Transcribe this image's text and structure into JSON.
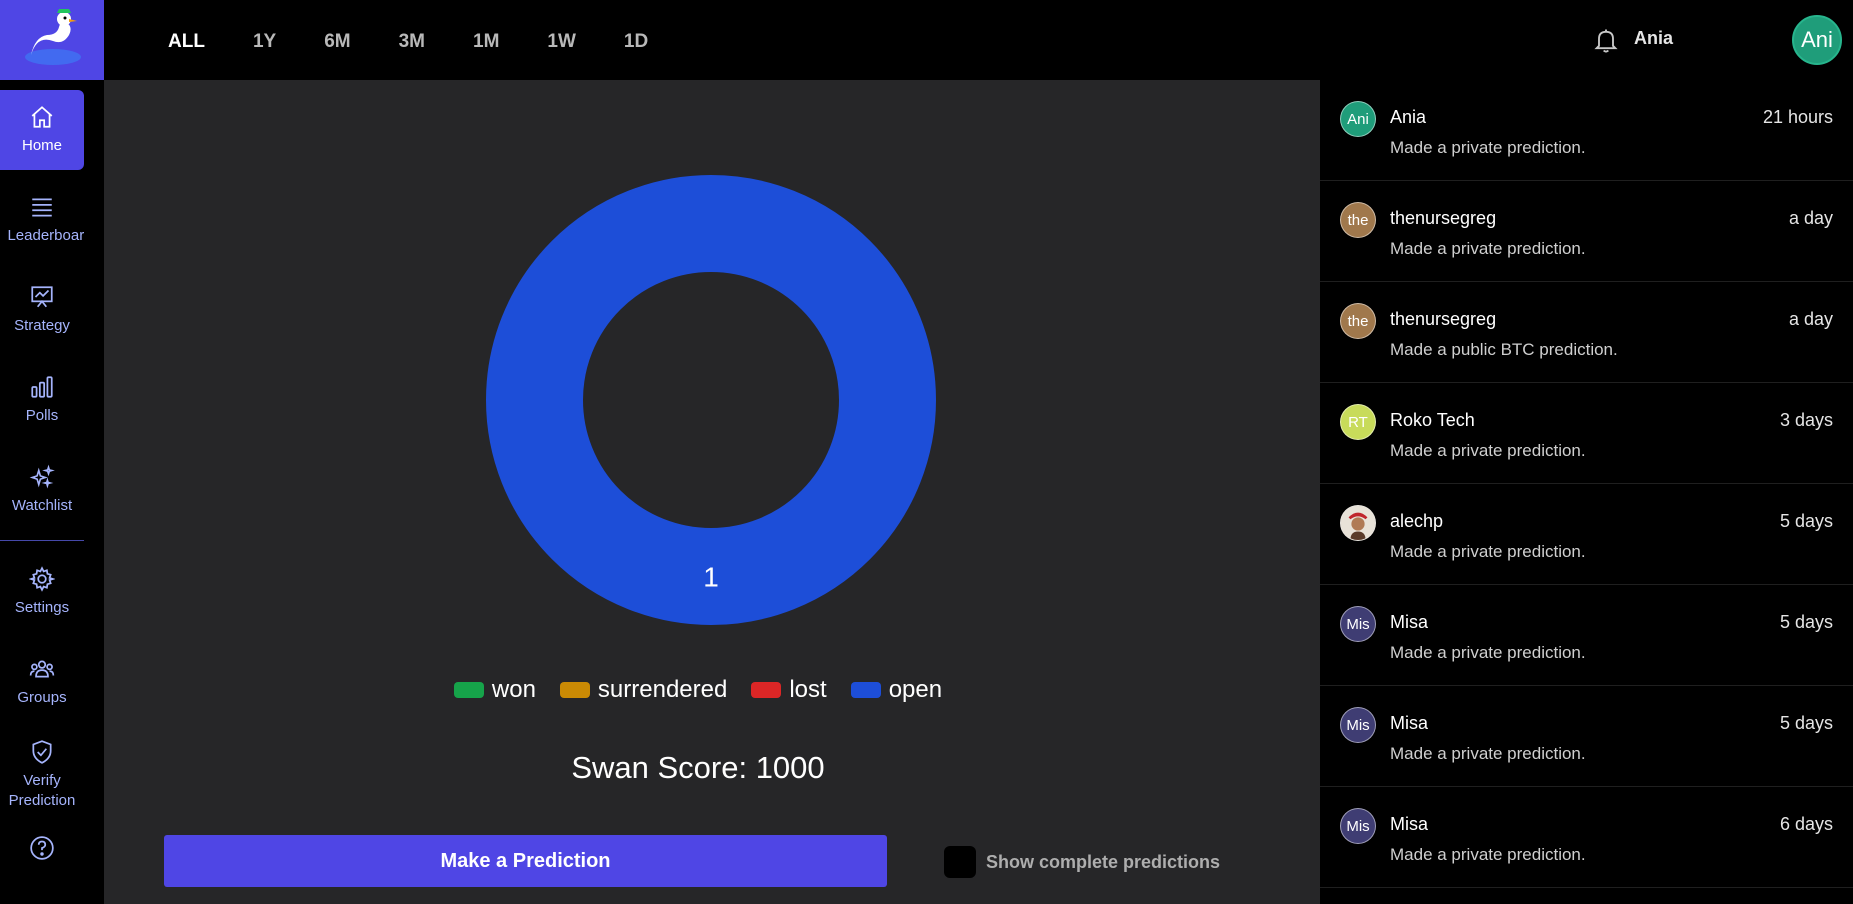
{
  "sidebar": {
    "items": [
      {
        "label": "Home",
        "icon": "home-icon",
        "active": true
      },
      {
        "label": "Leaderboard",
        "icon": "list-icon"
      },
      {
        "label": "Strategy",
        "icon": "chart-board-icon"
      },
      {
        "label": "Polls",
        "icon": "bar-chart-icon"
      },
      {
        "label": "Watchlist",
        "icon": "sparkles-icon"
      },
      {
        "label": "Settings",
        "icon": "gear-icon"
      },
      {
        "label": "Groups",
        "icon": "users-icon"
      },
      {
        "label": "Verify Prediction",
        "icon": "shield-check-icon"
      }
    ]
  },
  "topbar": {
    "ranges": [
      "ALL",
      "1Y",
      "6M",
      "3M",
      "1M",
      "1W",
      "1D"
    ],
    "active_range": "ALL",
    "username": "Ania",
    "avatar_initials": "Ani"
  },
  "chart_data": {
    "type": "pie",
    "categories": [
      "won",
      "surrendered",
      "lost",
      "open"
    ],
    "values": [
      0,
      0,
      0,
      1
    ],
    "colors": [
      "#16a34a",
      "#ca8a04",
      "#dc2626",
      "#1d4ed8"
    ],
    "data_label": "1",
    "legend": "bottom"
  },
  "main": {
    "score_text": "Swan Score: 1000",
    "predict_button": "Make a Prediction",
    "complete_toggle_label": "Show complete predictions"
  },
  "feed": [
    {
      "initials": "Ani",
      "name": "Ania",
      "time": "21 hours",
      "desc": "Made a private prediction.",
      "color": "#1f9d7a"
    },
    {
      "initials": "the",
      "name": "thenursegreg",
      "time": "a day",
      "desc": "Made a private prediction.",
      "color": "#a0784c"
    },
    {
      "initials": "the",
      "name": "thenursegreg",
      "time": "a day",
      "desc": "Made a public BTC prediction.",
      "color": "#a0784c"
    },
    {
      "initials": "RT",
      "name": "Roko Tech",
      "time": "3 days",
      "desc": "Made a private prediction.",
      "color": "#c8db5a"
    },
    {
      "initials": "",
      "name": "alechp",
      "time": "5 days",
      "desc": "Made a private prediction.",
      "color": "#d9d0c4"
    },
    {
      "initials": "Mis",
      "name": "Misa",
      "time": "5 days",
      "desc": "Made a private prediction.",
      "color": "#3f3d73"
    },
    {
      "initials": "Mis",
      "name": "Misa",
      "time": "5 days",
      "desc": "Made a private prediction.",
      "color": "#3f3d73"
    },
    {
      "initials": "Mis",
      "name": "Misa",
      "time": "6 days",
      "desc": "Made a private prediction.",
      "color": "#3f3d73"
    }
  ]
}
